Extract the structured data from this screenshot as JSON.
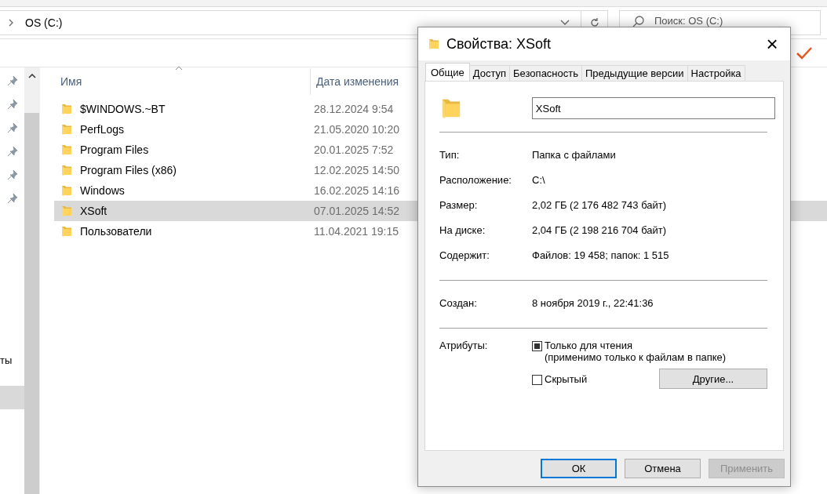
{
  "explorer": {
    "address": {
      "path": "OS (C:)"
    },
    "search": {
      "placeholder": "Поиск: OS (C:)"
    },
    "nav": {
      "items": [
        {
          "label": "ты",
          "selected": false
        },
        {
          "selected": true
        }
      ]
    },
    "columns": [
      "Имя",
      "Дата изменения"
    ],
    "rows": [
      {
        "name": "$WINDOWS.~BT",
        "date": "28.12.2024 9:54",
        "selected": false
      },
      {
        "name": "PerfLogs",
        "date": "21.05.2020 10:20",
        "selected": false
      },
      {
        "name": "Program Files",
        "date": "20.01.2025 7:52",
        "selected": false
      },
      {
        "name": "Program Files (x86)",
        "date": "12.02.2025 14:50",
        "selected": false
      },
      {
        "name": "Windows",
        "date": "16.02.2025 14:16",
        "selected": false
      },
      {
        "name": "XSoft",
        "date": "07.01.2025 14:52",
        "selected": true
      },
      {
        "name": "Пользователи",
        "date": "11.04.2021 19:15",
        "selected": false
      }
    ]
  },
  "dialog": {
    "title": "Свойства: XSoft",
    "close": "×",
    "tabs": [
      {
        "label": "Общие",
        "selected": true
      },
      {
        "label": "Доступ",
        "selected": false
      },
      {
        "label": "Безопасность",
        "selected": false
      },
      {
        "label": "Предыдущие версии",
        "selected": false
      },
      {
        "label": "Настройка",
        "selected": false
      }
    ],
    "name_value": "XSoft",
    "groups": [
      [
        {
          "label": "Тип:",
          "value": "Папка с файлами"
        },
        {
          "label": "Расположение:",
          "value": "C:\\"
        },
        {
          "label": "Размер:",
          "value": "2,02 ГБ (2 176 482 743 байт)"
        },
        {
          "label": "На диске:",
          "value": "2,04 ГБ (2 198 216 704 байт)"
        },
        {
          "label": "Содержит:",
          "value": "Файлов: 19 458; папок: 1 515"
        }
      ],
      [
        {
          "label": "Создан:",
          "value": "8 ноября 2019 г., 22:41:36"
        }
      ]
    ],
    "attributes": {
      "label": "Атрибуты:",
      "items": [
        {
          "label": "Только для чтения",
          "note": "(применимо только к файлам в папке)",
          "checked": false,
          "indeterminate": true
        },
        {
          "label": "Скрытый",
          "checked": false,
          "indeterminate": false
        }
      ],
      "more_button": "Другие..."
    },
    "buttons": [
      {
        "label": "ОК",
        "default": true,
        "disabled": false
      },
      {
        "label": "Отмена",
        "default": false,
        "disabled": false
      },
      {
        "label": "Применить",
        "default": false,
        "disabled": true
      }
    ]
  }
}
